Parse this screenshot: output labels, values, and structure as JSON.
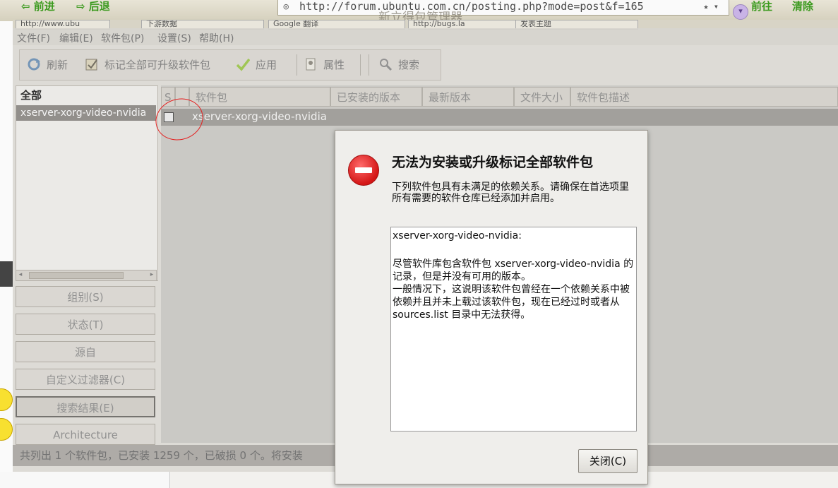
{
  "browser": {
    "back_label": "前进",
    "forward_label": "后退",
    "url": "http://forum.ubuntu.com.cn/posting.php?mode=post&f=165",
    "go_label": "前往",
    "clear_label": "清除",
    "ghost_title": "新立得包管理器",
    "tabs": [
      "http://www.ubu",
      "下游数据",
      "Google 翻译",
      "http://bugs.la",
      "发表主题"
    ]
  },
  "menu": [
    "文件(F)",
    "编辑(E)",
    "软件包(P)",
    "设置(S)",
    "帮助(H)"
  ],
  "toolbar": {
    "refresh": "刷新",
    "mark_all": "标记全部可升级软件包",
    "apply": "应用",
    "properties": "属性",
    "search": "搜索"
  },
  "sidebar": {
    "header": "全部",
    "selected_item": "xserver-xorg-video-nvidia",
    "filters": [
      "组别(S)",
      "状态(T)",
      "源自",
      "自定义过滤器(C)",
      "搜索结果(E)",
      "Architecture"
    ]
  },
  "columns": [
    "S",
    "",
    "软件包",
    "已安装的版本",
    "最新版本",
    "文件大小",
    "软件包描述"
  ],
  "package_row": {
    "name": "xserver-xorg-video-nvidia"
  },
  "status_bar": "共列出 1 个软件包，已安装 1259 个，已破损 0 个。将安装",
  "dialog": {
    "title": "无法为安装或升级标记全部软件包",
    "message": "下列软件包具有未满足的依赖关系。请确保在首选项里所有需要的软件仓库已经添加并启用。",
    "details_heading": "xserver-xorg-video-nvidia:",
    "details_para1": "尽管软件库包含软件包 xserver-xorg-video-nvidia 的记录，但是并没有可用的版本。",
    "details_para2": "一般情况下，这说明该软件包曾经在一个依赖关系中被依赖并且并未上载过该软件包，现在已经过时或者从 sources.list 目录中无法获得。",
    "close_button": "关闭(C)"
  },
  "colors": {
    "error_red": "#d41616",
    "annotation_red": "#e41f1f"
  }
}
